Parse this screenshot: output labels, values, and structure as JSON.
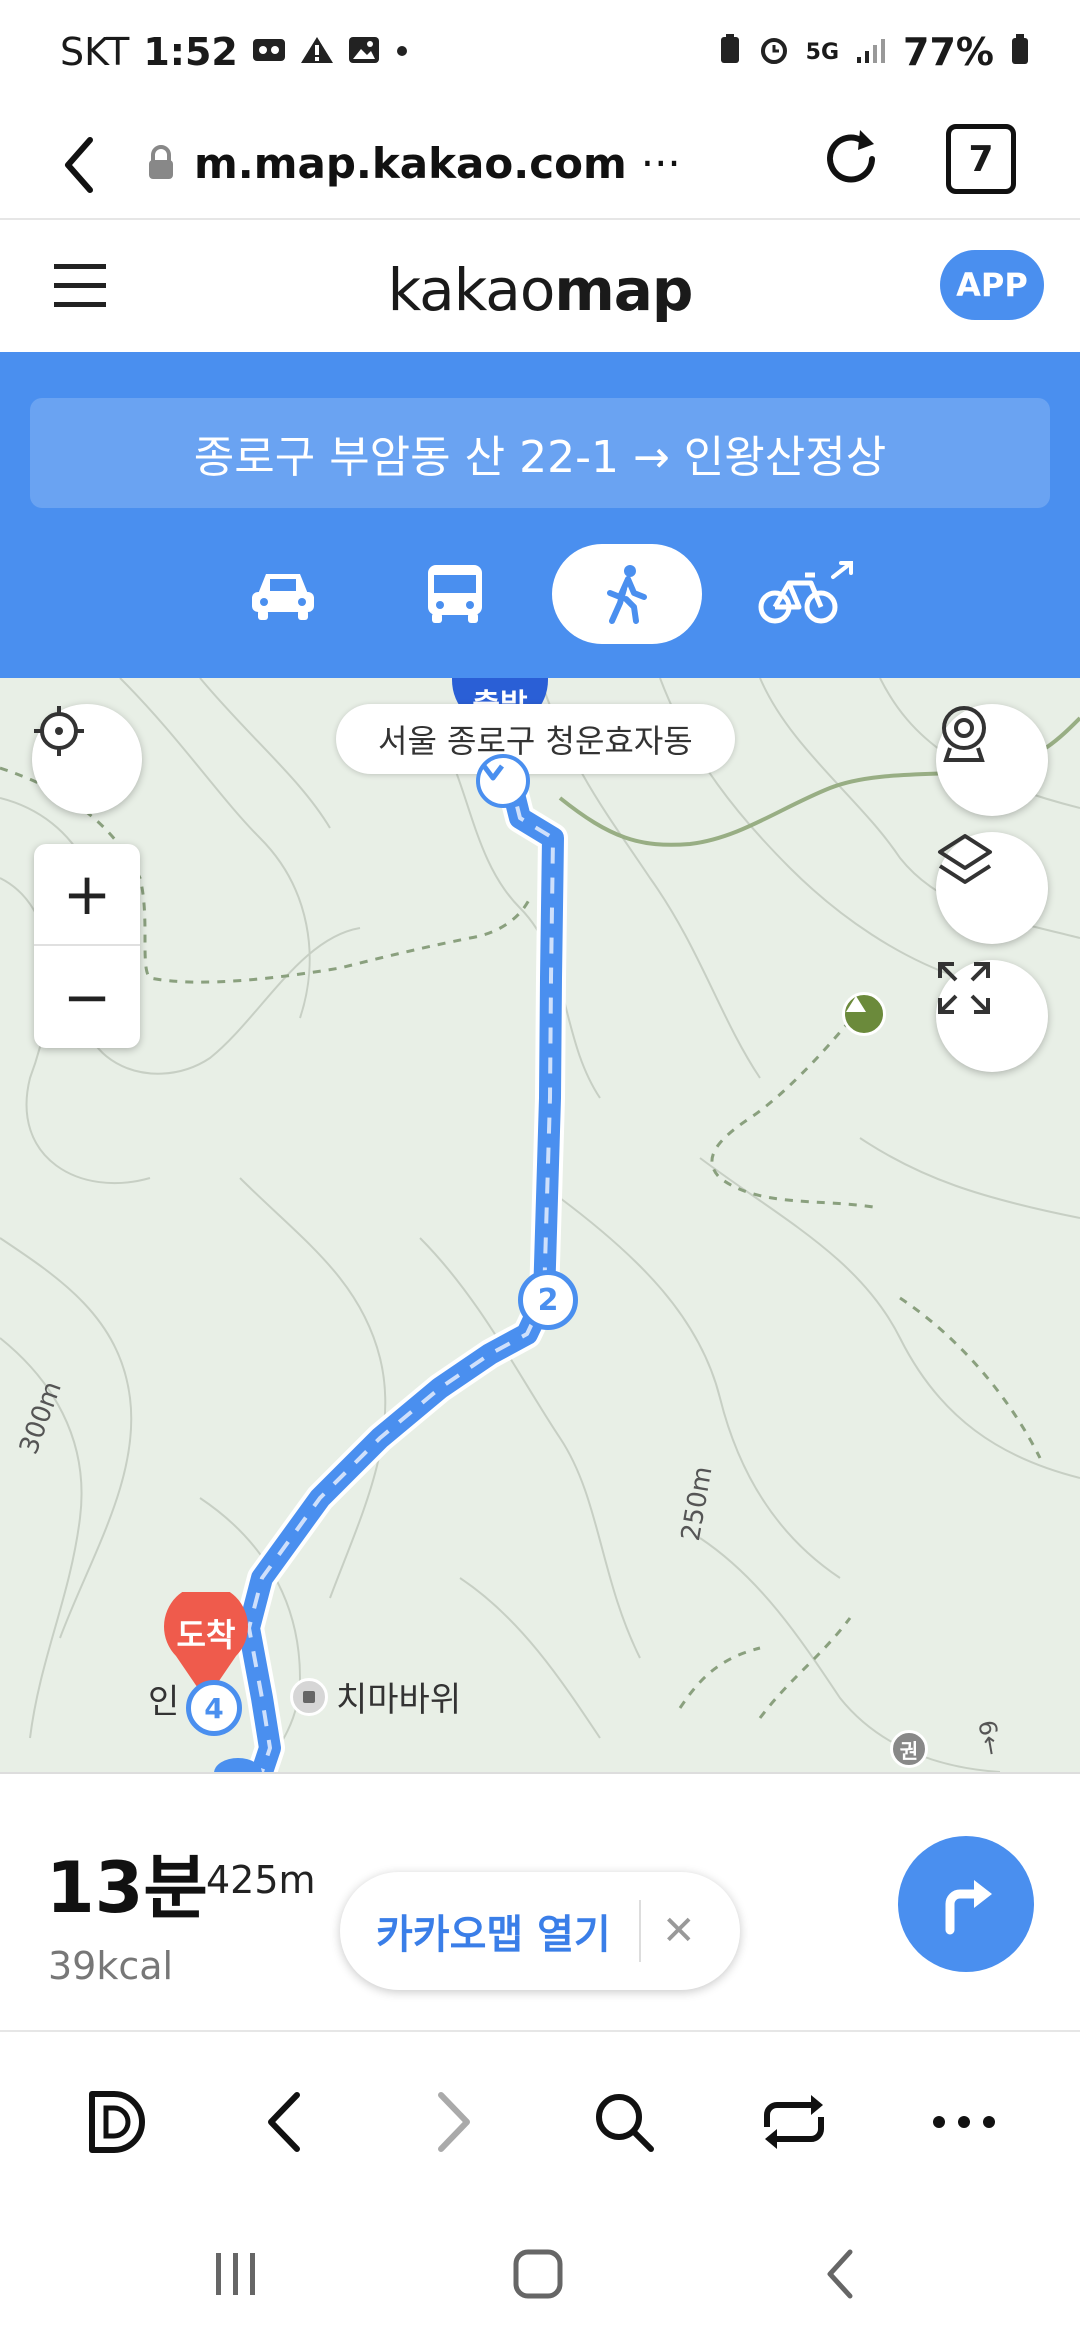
{
  "status_bar": {
    "carrier": "SKT",
    "time": "1:52",
    "network": "5G",
    "battery": "77%"
  },
  "browser": {
    "url": "m.map.kakao.com",
    "url_more": "···",
    "tab_count": "7"
  },
  "header": {
    "logo_light": "kakao",
    "logo_bold": "map",
    "app_button": "APP"
  },
  "route": {
    "summary": "종로구 부암동 산 22-1 → 인왕산정상",
    "modes": [
      "car",
      "bus",
      "walk",
      "bike"
    ],
    "selected_mode": "walk"
  },
  "map": {
    "region_label": "서울 종로구 청운효자동",
    "start_badge": "출발",
    "arrive_badge": "도착",
    "waypoint_2": "2",
    "waypoint_4": "4",
    "poi_chima": "치마바위",
    "poi_in_partial": "인",
    "contour_300": "300m",
    "contour_250": "250m",
    "trail_label": "6←",
    "zoom_in": "+",
    "zoom_out": "−",
    "route_color": "#4a8fef"
  },
  "route_info": {
    "duration": "13분",
    "distance": "425m",
    "calories": "39kcal",
    "open_app_label": "카카오맵 열기",
    "close_symbol": "✕"
  },
  "colors": {
    "accent": "#4a8fef",
    "arrive_pin": "#ef5b4c",
    "map_bg": "#e8efe6"
  }
}
